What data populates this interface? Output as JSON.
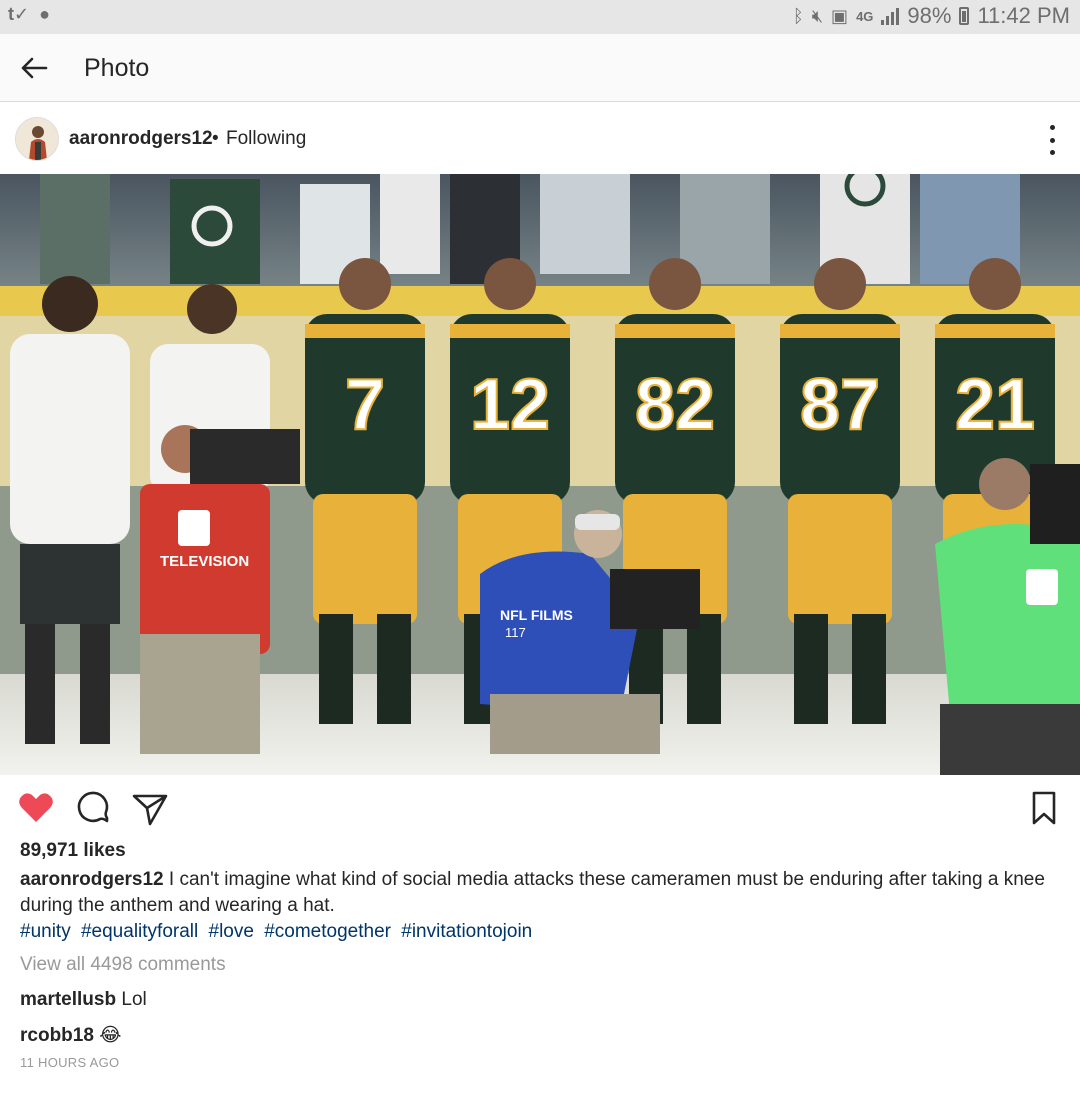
{
  "status_bar": {
    "battery": "98%",
    "time": "11:42 PM",
    "network": "4G"
  },
  "app_bar": {
    "title": "Photo"
  },
  "post": {
    "username": "aaronrodgers12",
    "follow_status": "Following",
    "separator": "•",
    "jersey_numbers": [
      "7",
      "12",
      "82",
      "87",
      "21"
    ],
    "likes": "89,971 likes",
    "caption": {
      "username": "aaronrodgers12",
      "text": "I can't imagine what kind of social media attacks these cameramen must be enduring after taking a knee during the anthem and wearing a hat."
    },
    "hashtags": [
      "#unity",
      "#equalityforall",
      "#love",
      "#cometogether",
      "#invitationtojoin"
    ],
    "view_comments": "View all 4498 comments",
    "comments": [
      {
        "username": "martellusb",
        "text": "Lol"
      },
      {
        "username": "rcobb18",
        "text": "😂"
      }
    ],
    "timestamp": "11 HOURS AGO"
  },
  "colors": {
    "heart": "#ed4956",
    "hashtag": "#003569",
    "muted": "#999999",
    "jersey_green": "#1f3a2c",
    "jersey_gold": "#e8b23a"
  }
}
